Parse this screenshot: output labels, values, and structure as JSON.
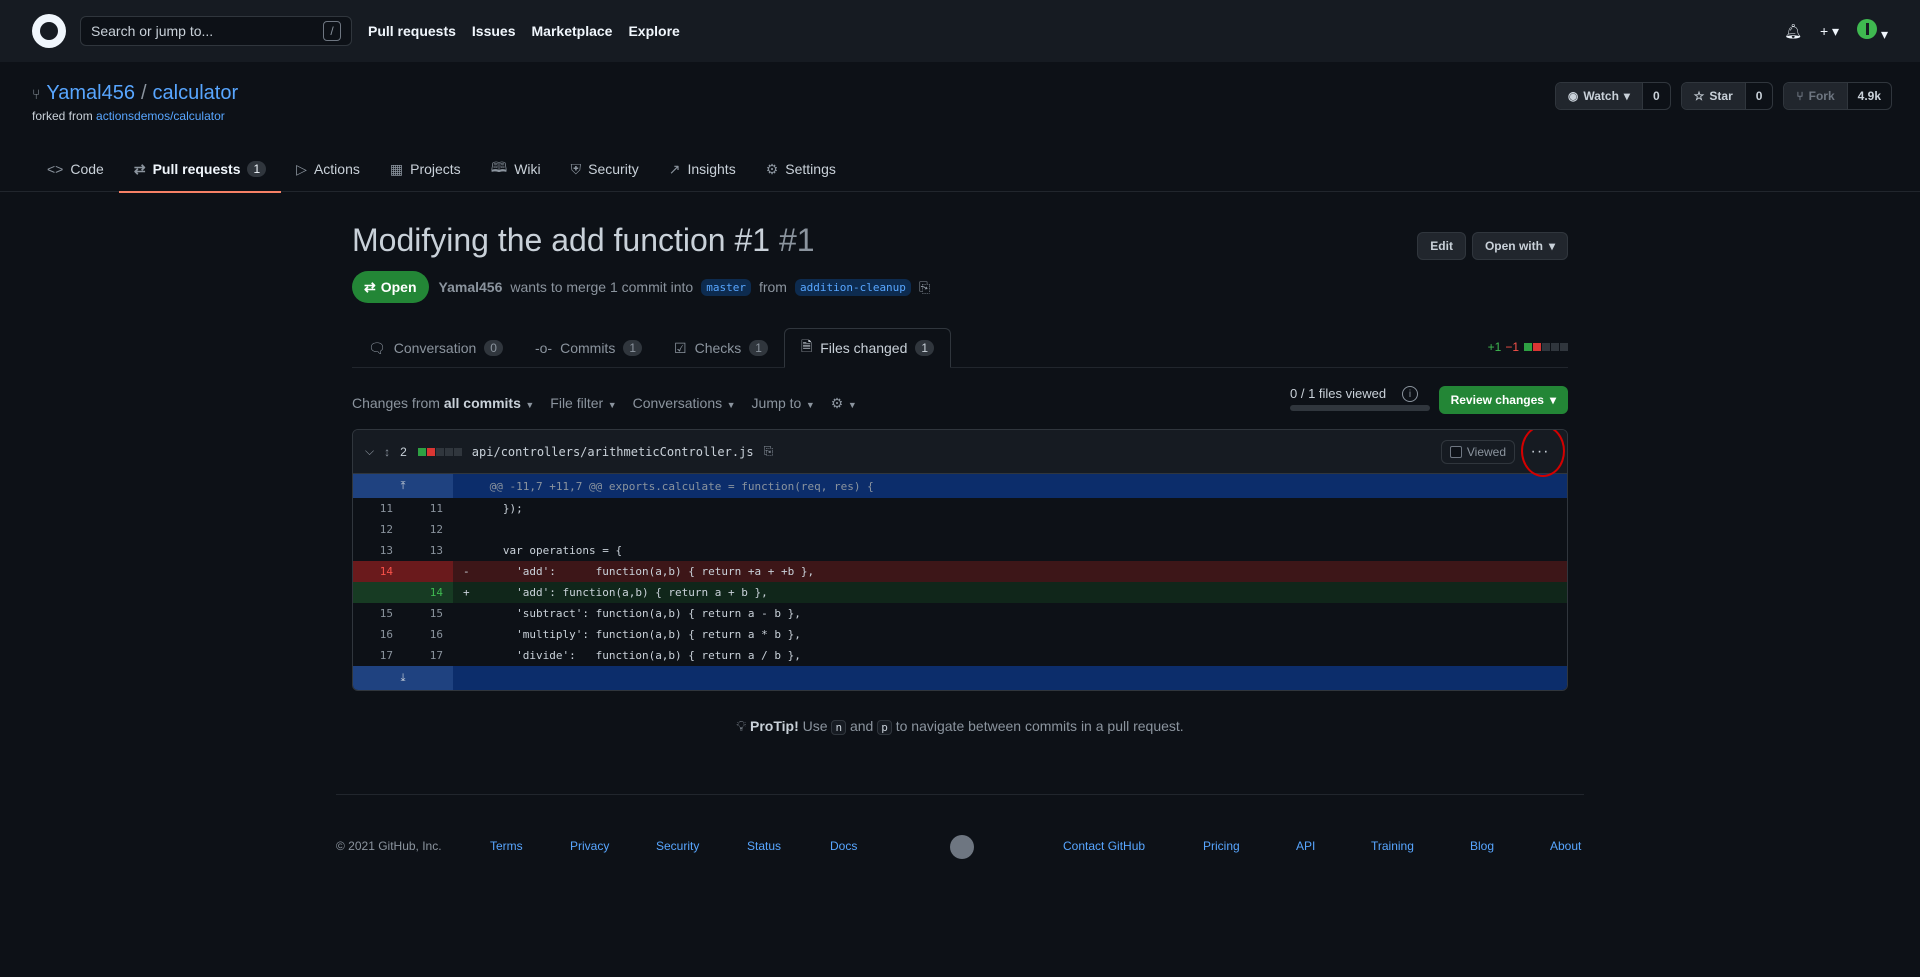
{
  "header": {
    "search_placeholder": "Search or jump to...",
    "search_shortcut": "/",
    "nav": [
      "Pull requests",
      "Issues",
      "Marketplace",
      "Explore"
    ]
  },
  "repo": {
    "owner": "Yamal456",
    "name": "calculator",
    "forked_from_prefix": "forked from",
    "forked_from": "actionsdemos/calculator",
    "watch_label": "Watch",
    "watch_count": "0",
    "star_label": "Star",
    "star_count": "0",
    "fork_label": "Fork",
    "fork_count": "4.9k"
  },
  "repo_nav": [
    {
      "label": "Code",
      "icon": "code-icon"
    },
    {
      "label": "Pull requests",
      "icon": "pull-request-icon",
      "count": "1"
    },
    {
      "label": "Actions",
      "icon": "play-icon"
    },
    {
      "label": "Projects",
      "icon": "project-icon"
    },
    {
      "label": "Wiki",
      "icon": "book-icon"
    },
    {
      "label": "Security",
      "icon": "shield-icon"
    },
    {
      "label": "Insights",
      "icon": "graph-icon"
    },
    {
      "label": "Settings",
      "icon": "gear-icon"
    }
  ],
  "pr": {
    "title": "Modifying the add function #1",
    "number": "#1",
    "edit_label": "Edit",
    "open_with_label": "Open with",
    "state": "Open",
    "author": "Yamal456",
    "merge_text": "wants to merge 1 commit into",
    "base_branch": "master",
    "from_text": "from",
    "head_branch": "addition-cleanup"
  },
  "pr_tabs": [
    {
      "label": "Conversation",
      "count": "0",
      "icon": "comment-icon"
    },
    {
      "label": "Commits",
      "count": "1",
      "icon": "commit-icon"
    },
    {
      "label": "Checks",
      "count": "1",
      "icon": "checklist-icon"
    },
    {
      "label": "Files changed",
      "count": "1",
      "icon": "file-diff-icon"
    }
  ],
  "diffstat": {
    "additions": "+1",
    "deletions": "−1"
  },
  "toolbar": {
    "changes_prefix": "Changes from",
    "changes_value": "all commits",
    "file_filter": "File filter",
    "conversations": "Conversations",
    "jump_to": "Jump to",
    "files_viewed": "0 / 1 files viewed",
    "review_changes": "Review changes"
  },
  "file": {
    "changes_count": "2",
    "path": "api/controllers/arithmeticController.js",
    "viewed_label": "Viewed",
    "hunk_header": "@@ -11,7 +11,7 @@ exports.calculate = function(req, res) {",
    "lines": [
      {
        "type": "ctx",
        "old": "11",
        "new": "11",
        "code": "  });"
      },
      {
        "type": "ctx",
        "old": "12",
        "new": "12",
        "code": ""
      },
      {
        "type": "ctx",
        "old": "13",
        "new": "13",
        "code": "  var operations = {"
      },
      {
        "type": "del",
        "old": "14",
        "new": "",
        "code": "    'add':      function(a,b) { return +a + +b },"
      },
      {
        "type": "add",
        "old": "",
        "new": "14",
        "code": "    'add': function(a,b) { return a + b },"
      },
      {
        "type": "ctx",
        "old": "15",
        "new": "15",
        "code": "    'subtract': function(a,b) { return a - b },"
      },
      {
        "type": "ctx",
        "old": "16",
        "new": "16",
        "code": "    'multiply': function(a,b) { return a * b },"
      },
      {
        "type": "ctx",
        "old": "17",
        "new": "17",
        "code": "    'divide':   function(a,b) { return a / b },"
      }
    ]
  },
  "protip": {
    "label": "ProTip!",
    "text_1": "Use",
    "key_1": "n",
    "text_2": "and",
    "key_2": "p",
    "text_3": "to navigate between commits in a pull request."
  },
  "footer": {
    "copyright": "© 2021 GitHub, Inc.",
    "left_links": [
      "Terms",
      "Privacy",
      "Security",
      "Status",
      "Docs"
    ],
    "right_links": [
      "Contact GitHub",
      "Pricing",
      "API",
      "Training",
      "Blog",
      "About"
    ]
  },
  "colors": {
    "accent": "#58a6ff",
    "success": "#238636",
    "danger": "#f85149",
    "tab_underline": "#f78166",
    "annotation": "#d30000"
  }
}
